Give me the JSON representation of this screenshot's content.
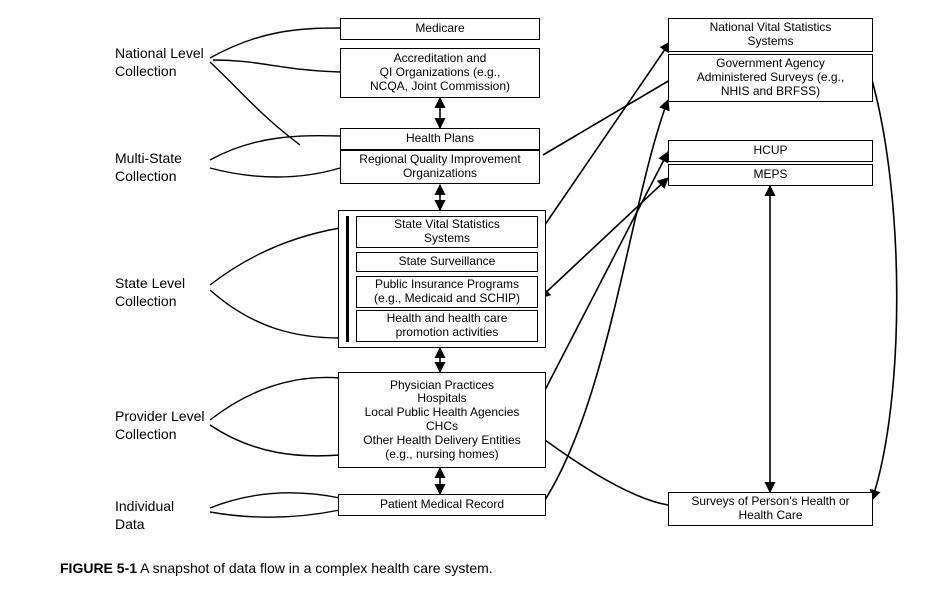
{
  "labels": {
    "national": "National Level\nCollection",
    "multistate": "Multi-State\nCollection",
    "state": "State Level\nCollection",
    "provider": "Provider Level\nCollection",
    "individual": "Individual\nData"
  },
  "boxes": {
    "medicare": "Medicare",
    "accreditation": "Accreditation and\nQI Organizations (e.g.,\nNCQA, Joint Commission)",
    "nvss": "National Vital Statistics\nSystems",
    "govsurveys": "Government Agency\nAdministered Surveys (e.g.,\nNHIS and BRFSS)",
    "healthplans": "Health Plans",
    "rqio": "Regional Quality Improvement\nOrganizations",
    "hcup": "HCUP",
    "meps": "MEPS",
    "svss": "State Vital Statistics\nSystems",
    "surveillance": "State Surveillance",
    "pubins": "Public Insurance Programs\n(e.g., Medicaid and SCHIP)",
    "promotion": "Health and health care\npromotion activities",
    "providers": "Physician Practices\nHospitals\nLocal Public Health Agencies\nCHCs\nOther Health Delivery Entities\n(e.g., nursing homes)",
    "pmr": "Patient Medical Record",
    "surveyperson": "Surveys of Person's Health or\nHealth Care"
  },
  "caption_bold": "FIGURE 5-1",
  "caption_rest": " A snapshot of data flow in a complex health care system."
}
